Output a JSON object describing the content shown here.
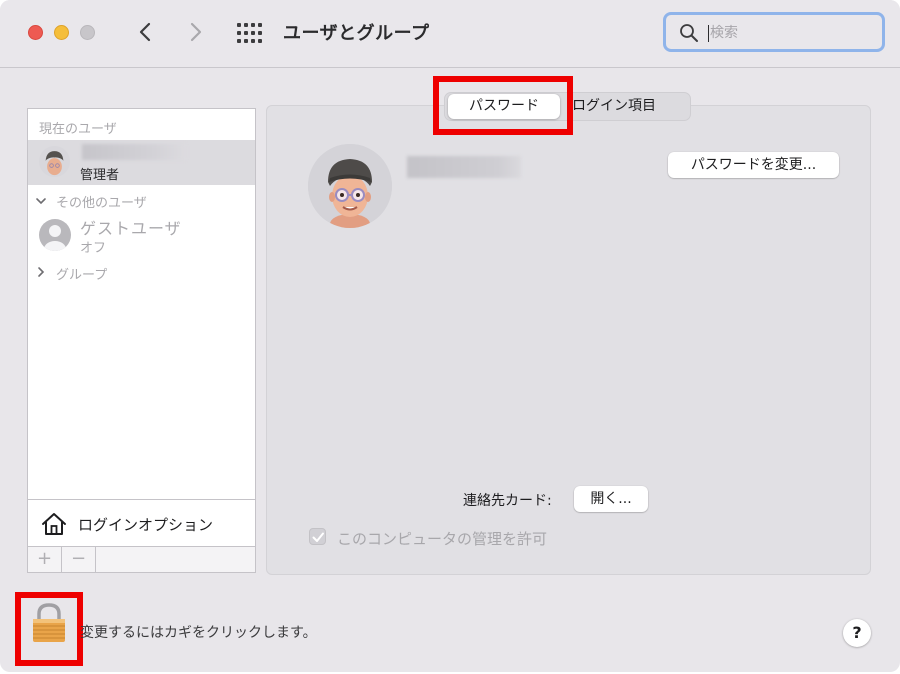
{
  "window": {
    "title": "ユーザとグループ"
  },
  "toolbar": {
    "back_icon": "chevron-left-icon",
    "forward_icon": "chevron-right-icon",
    "show_all_icon": "grid-icon"
  },
  "search": {
    "placeholder": "検索",
    "value": ""
  },
  "sidebar": {
    "current_users_label": "現在のユーザ",
    "current_user": {
      "name": "",
      "role": "管理者"
    },
    "other_users_label": "その他のユーザ",
    "guest_user": {
      "name": "ゲストユーザ",
      "status": "オフ"
    },
    "groups_label": "グループ",
    "login_options_label": "ログインオプション",
    "add_button": "+",
    "remove_button": "−"
  },
  "tabs": [
    {
      "label": "パスワード",
      "selected": true
    },
    {
      "label": "ログイン項目",
      "selected": false
    }
  ],
  "main": {
    "change_password_button": "パスワードを変更...",
    "contact_card_label": "連絡先カード:",
    "open_button": "開く...",
    "allow_admin_label": "このコンピュータの管理を許可",
    "allow_admin_checked": true
  },
  "footer": {
    "lock_text": "変更するにはカギをクリックします。",
    "help_button": "?"
  },
  "colors": {
    "highlight_box": "#ee0000",
    "search_focus": "#8fb4ea",
    "window_background": "#e8e6ea"
  }
}
